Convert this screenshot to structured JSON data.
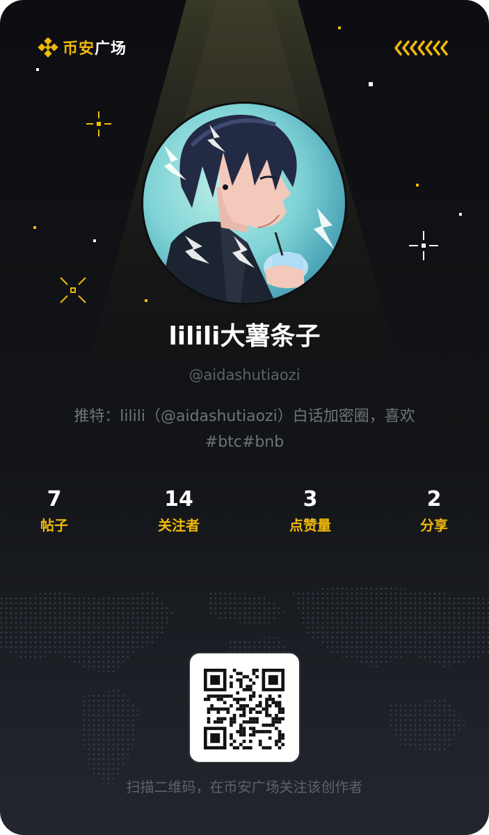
{
  "header": {
    "logo_brand": "币安",
    "logo_suffix": "广场",
    "logo_icon": "binance-diamond-icon",
    "share_icon": "chevrons-left-icon"
  },
  "profile": {
    "display_name": "lilili大薯条子",
    "handle": "@aidashutiaozi",
    "bio": "推特：lilili（@aidashutiaozi）白话加密圈，喜欢#btc#bnb"
  },
  "stats": [
    {
      "value": "7",
      "label": "帖子"
    },
    {
      "value": "14",
      "label": "关注者"
    },
    {
      "value": "3",
      "label": "点赞量"
    },
    {
      "value": "2",
      "label": "分享"
    }
  ],
  "footer": {
    "caption": "扫描二维码，在币安广场关注该创作者"
  },
  "colors": {
    "accent": "#f0b90b",
    "background": "#0d0e11",
    "muted_text": "#5d6169"
  }
}
